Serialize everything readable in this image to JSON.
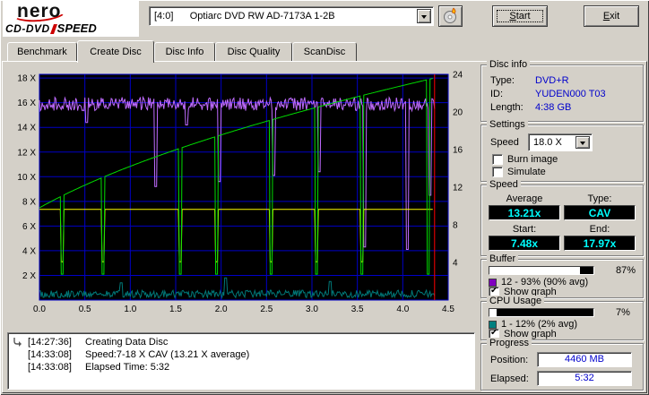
{
  "header": {
    "logo": {
      "line1": "nero",
      "line2": "CD-DVD",
      "line3": "SPEED"
    },
    "drive_select": {
      "value": "[4:0]      Optiarc DVD RW AD-7173A 1-2B"
    },
    "start_button": "Start",
    "exit_button": "Exit"
  },
  "tabs": [
    {
      "label": "Benchmark",
      "active": false
    },
    {
      "label": "Create Disc",
      "active": true
    },
    {
      "label": "Disc Info",
      "active": false
    },
    {
      "label": "Disc Quality",
      "active": false
    },
    {
      "label": "ScanDisc",
      "active": false
    }
  ],
  "chart_data": {
    "type": "line",
    "title": "",
    "xlabel": "",
    "ylabel": "",
    "x_range": [
      0,
      4.5
    ],
    "x_ticks": [
      {
        "v": 0,
        "label": "0.0"
      },
      {
        "v": 0.5,
        "label": "0.5"
      },
      {
        "v": 1,
        "label": "1.0"
      },
      {
        "v": 1.5,
        "label": "1.5"
      },
      {
        "v": 2,
        "label": "2.0"
      },
      {
        "v": 2.5,
        "label": "2.5"
      },
      {
        "v": 3,
        "label": "3.0"
      },
      {
        "v": 3.5,
        "label": "3.5"
      },
      {
        "v": 4,
        "label": "4.0"
      },
      {
        "v": 4.5,
        "label": "4.5"
      }
    ],
    "y_left_range": [
      0,
      18.3
    ],
    "y_left_ticks": [
      {
        "v": 18,
        "label": "18 X"
      },
      {
        "v": 16,
        "label": "16 X"
      },
      {
        "v": 14,
        "label": "14 X"
      },
      {
        "v": 12,
        "label": "12 X"
      },
      {
        "v": 10,
        "label": "10 X"
      },
      {
        "v": 8,
        "label": "8 X"
      },
      {
        "v": 6,
        "label": "6 X"
      },
      {
        "v": 4,
        "label": "4 X"
      },
      {
        "v": 2,
        "label": "2 X"
      }
    ],
    "y_right_range": [
      0,
      24
    ],
    "y_right_ticks": [
      {
        "v": 24,
        "label": "24"
      },
      {
        "v": 20,
        "label": "20"
      },
      {
        "v": 16,
        "label": "16"
      },
      {
        "v": 12,
        "label": "12"
      },
      {
        "v": 8,
        "label": "8"
      },
      {
        "v": 4,
        "label": "4"
      }
    ],
    "bg": "#000000",
    "grid_color": "#0000c8",
    "grid": true,
    "legend_position": "none",
    "series": [
      {
        "name": "cpu-usage",
        "color": "#007878",
        "type": "noise",
        "base": 0.5,
        "amp": 0.3,
        "x_end": 4.35,
        "spikes": [
          {
            "x": 0.9,
            "v": 1.4
          },
          {
            "x": 2.05,
            "v": 1.8
          },
          {
            "x": 3.2,
            "v": 1.5
          }
        ]
      },
      {
        "name": "buffer-level",
        "color": "#c06bff",
        "type": "noise",
        "base": 15.9,
        "amp": 0.55,
        "x_end": 4.35,
        "spikes": [
          {
            "x": 0.52,
            "v": 14.4
          },
          {
            "x": 1.28,
            "v": 9.2
          },
          {
            "x": 1.62,
            "v": 14.2
          },
          {
            "x": 1.98,
            "v": 9.6
          },
          {
            "x": 2.58,
            "v": 10.1
          },
          {
            "x": 3.08,
            "v": 10.4
          },
          {
            "x": 3.58,
            "v": 4.3
          },
          {
            "x": 4.05,
            "v": 4.1
          },
          {
            "x": 4.3,
            "v": 8.5
          }
        ]
      },
      {
        "name": "secondary-speed",
        "color": "#ffff00",
        "type": "flat",
        "value": 7.35,
        "x_end": 4.33,
        "dips_x": [
          0.25,
          0.7,
          1.55,
          1.95,
          2.55,
          3.05,
          3.55
        ],
        "dip_depth": 3.1
      },
      {
        "name": "write-speed",
        "color": "#00dd00",
        "type": "cav",
        "start": 7.48,
        "end": 17.97,
        "x_end": 4.33,
        "dips_x": [
          0.25,
          0.7,
          1.55,
          1.95,
          2.55,
          3.05,
          3.55,
          4.28
        ],
        "dip_depth": 2.1
      }
    ],
    "position_line": {
      "x": 4.35,
      "color": "#ff0000"
    }
  },
  "disc_info": {
    "title": "Disc info",
    "rows": [
      {
        "label": "Type:",
        "value": "DVD+R"
      },
      {
        "label": "ID:",
        "value": "YUDEN000 T03"
      },
      {
        "label": "Length:",
        "value": "4:38 GB"
      }
    ]
  },
  "settings": {
    "title": "Settings",
    "speed_label": "Speed",
    "speed_value": "18.0 X",
    "checkboxes": [
      {
        "label": "Burn image",
        "checked": false
      },
      {
        "label": "Simulate",
        "checked": false
      }
    ]
  },
  "speed_panel": {
    "title": "Speed",
    "average_label": "Average",
    "average_value": "13.21x",
    "type_label": "Type:",
    "type_value": "CAV",
    "start_label": "Start:",
    "start_value": "7.48x",
    "end_label": "End:",
    "end_value": "17.97x"
  },
  "buffer": {
    "title": "Buffer",
    "percent": 87,
    "percent_label": "87%",
    "swatch_color": "#8000c0",
    "range_label": "12 - 93% (90% avg)",
    "show_graph_label": "Show graph",
    "show_graph_checked": true
  },
  "cpu": {
    "title": "CPU Usage",
    "percent": 7,
    "percent_label": "7%",
    "swatch_color": "#008080",
    "range_label": "1 - 12% (2% avg)",
    "show_graph_label": "Show graph",
    "show_graph_checked": true
  },
  "progress": {
    "title": "Progress",
    "position_label": "Position:",
    "position_value": "4460 MB",
    "elapsed_label": "Elapsed:",
    "elapsed_value": "5:32"
  },
  "log": {
    "entries": [
      {
        "time": "[14:27:36]",
        "text": "Creating Data Disc"
      },
      {
        "time": "[14:33:08]",
        "text": "Speed:7-18 X CAV (13.21 X average)"
      },
      {
        "time": "[14:33:08]",
        "text": "Elapsed Time: 5:32"
      }
    ]
  }
}
